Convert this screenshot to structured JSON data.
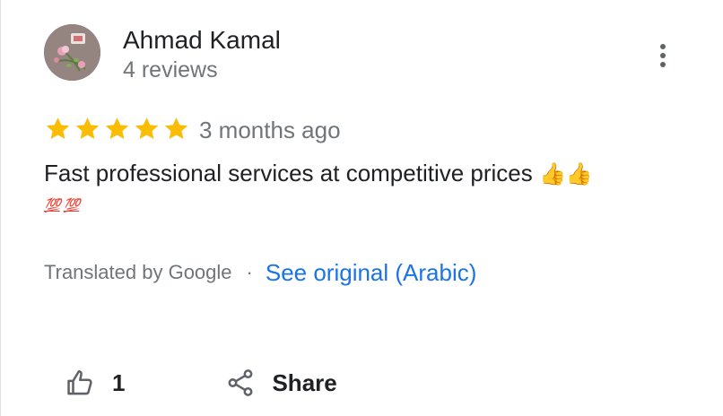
{
  "author": {
    "name": "Ahmad Kamal",
    "reviews": "4 reviews"
  },
  "review": {
    "rating": 5,
    "rating_max": 5,
    "time": "3 months ago",
    "text": "Fast professional services at competitive prices",
    "text_emoji": "👍👍",
    "emoji_line": [
      "💯",
      "💯"
    ],
    "translated_label": "Translated by Google",
    "separator": "·",
    "see_original_label": "See original (Arabic)"
  },
  "actions": {
    "like_count": "1",
    "share_label": "Share"
  },
  "colors": {
    "star": "#fbbc04",
    "link": "#1a73e8",
    "secondary_text": "#70757a",
    "icon": "#5f6368"
  },
  "icons": {
    "more": "more-vert-icon",
    "like": "thumb-up-icon",
    "share": "share-icon",
    "star": "star-icon"
  }
}
